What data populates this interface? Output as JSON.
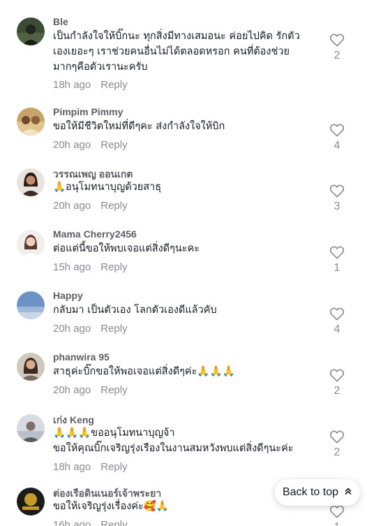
{
  "comments": [
    {
      "username": "Ble",
      "lines": [
        "เป็นกำลังใจให้บิ๊กนะ ทุกสิ่งมีทางเสมอนะ ค่อยไปคิด รักตัว",
        "เองเยอะๆ เราช่วยคนอื่นไม่ได้ตลอดหรอก คนที่ต้องช่วย",
        "มากๆคือตัวเรานะครับ"
      ],
      "time": "18h ago",
      "reply": "Reply",
      "likes": "2"
    },
    {
      "username": "Pimpim Pimmy",
      "lines": [
        "ขอให้มีชีวิตใหม่ที่ดีๆคะ ส่งกำลังใจให้บิก"
      ],
      "time": "20h ago",
      "reply": "Reply",
      "likes": "4"
    },
    {
      "username": "วรรณเพญ ออนเกต",
      "lines": [
        "🙏อนุโมทนาบุญด้วยสาธุ"
      ],
      "time": "20h ago",
      "reply": "Reply",
      "likes": "3"
    },
    {
      "username": "Mama Cherry2456",
      "lines": [
        "ต่อแต่นี้ขอให้พบเจอแต่สิ่งดีๆนะคะ"
      ],
      "time": "15h ago",
      "reply": "Reply",
      "likes": "1"
    },
    {
      "username": "Happy",
      "lines": [
        "กลับมา เป็นตัวเอง โลกตัวเองดีแล้วคับ"
      ],
      "time": "20h ago",
      "reply": "Reply",
      "likes": "4"
    },
    {
      "username": "phanwira 95",
      "lines": [
        "สาธุค่ะบิ๊กขอให้พอเจอแต่สิ่งดีๆค่ะ🙏🙏🙏"
      ],
      "time": "20h ago",
      "reply": "Reply",
      "likes": "2"
    },
    {
      "username": "เก่ง Keng",
      "lines": [
        "🙏🙏🙏ขออนุโมทนาบุญจ้า",
        "ขอให้คุณบิ๊กเจริญรุ่งเรืองในงานสมหวังพบแต่สิ่งดีๆนะค่ะ"
      ],
      "time": "18h ago",
      "reply": "Reply",
      "likes": "2"
    },
    {
      "username": "ต่องเรือดินเนอร์เจ้าพระยา",
      "lines": [
        "ขอให้เจริญรุ่งเรื่องค่ะ🥰🙏"
      ],
      "time": "16h ago",
      "reply": "Reply",
      "likes": "1"
    }
  ],
  "back_to_top": {
    "label": "Back to top",
    "icon": "double-chevron-up-icon"
  }
}
